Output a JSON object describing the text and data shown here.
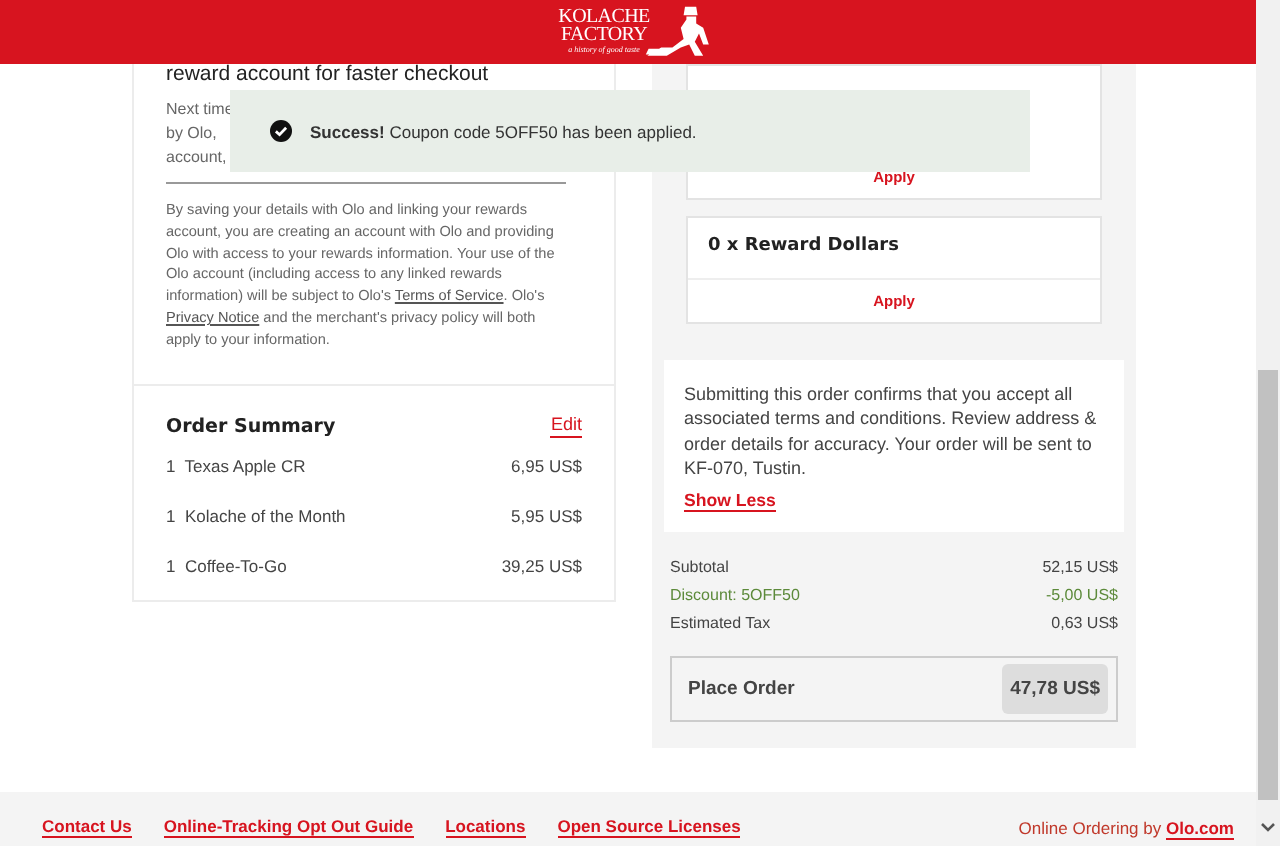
{
  "header": {
    "logo": {
      "line_1": "KOLACHE",
      "line_2": "FACTORY",
      "tagline": "a history of good taste"
    }
  },
  "toast": {
    "message": "**Success!** Coupon code 5OFF50 has been applied."
  },
  "account_card": {
    "heading": "reward account for faster checkout",
    "fragments": [
      "Next time",
      "by Olo,",
      "account,"
    ],
    "disclaimer": [
      {
        "kind": "text",
        "text": "By saving your details with Olo and linking your rewards account, you are creating an account with Olo and providing Olo with access to your rewards information. Your use of the Olo account (including access to any linked rewards information) will be subject to Olo's "
      },
      {
        "kind": "link",
        "text": "Terms of Service"
      },
      {
        "kind": "text",
        "text": ". Olo's "
      },
      {
        "kind": "link",
        "text": "Privacy Notice"
      },
      {
        "kind": "text",
        "text": " and the merchant's privacy policy will both apply to your information."
      }
    ]
  },
  "order_summary": {
    "title": "Order Summary",
    "edit": "Edit",
    "items": [
      {
        "qty": "1",
        "name": "Texas Apple CR",
        "price": "6,95 US$"
      },
      {
        "qty": "1",
        "name": "Kolache of the Month",
        "price": "5,95 US$"
      },
      {
        "qty": "1",
        "name": "Coffee-To-Go",
        "price": "39,25 US$"
      }
    ]
  },
  "rewards": [
    {
      "apply": "Apply"
    },
    {
      "title": "0 x Reward Dollars",
      "apply": "Apply"
    }
  ],
  "terms": {
    "text": "Submitting this order confirms that you accept all associated terms and conditions. Review address & order details for accuracy. Your order will be sent to KF-070, Tustin.",
    "toggle": "Show Less"
  },
  "totals": [
    {
      "kind": "plain",
      "label": "Subtotal",
      "value": "52,15 US$"
    },
    {
      "kind": "discount",
      "label": "Discount: 5OFF50",
      "value": "-5,00 US$"
    },
    {
      "kind": "plain",
      "label": "Estimated Tax",
      "value": "0,63 US$"
    }
  ],
  "place_order": {
    "label": "Place Order",
    "total": "47,78 US$"
  },
  "footer": {
    "links": [
      "Contact Us",
      "Online-Tracking Opt Out Guide",
      "Locations",
      "Open Source Licenses"
    ],
    "credit": "Online Ordering by ",
    "credit_link": "Olo.com"
  }
}
